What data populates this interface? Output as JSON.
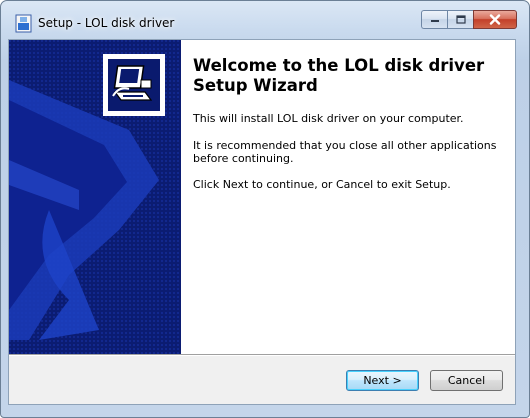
{
  "window": {
    "title": "Setup - LOL disk driver",
    "icons": {
      "app": "setup-app-icon",
      "minimize": "minimize-icon",
      "maximize": "maximize-icon",
      "close": "close-icon"
    }
  },
  "banner": {
    "logo_icon": "computer-disk-icon"
  },
  "welcome": {
    "title": "Welcome to the LOL disk driver Setup Wizard",
    "line1": "This will install LOL disk driver on your computer.",
    "line2": "It is recommended that you close all other applications before continuing.",
    "line3": "Click Next to continue, or Cancel to exit Setup."
  },
  "buttons": {
    "next": "Next >",
    "cancel": "Cancel"
  },
  "colors": {
    "banner_bg": "#0a1a6e",
    "banner_shape": "#1f3fbf",
    "next_border": "#3c7fb1"
  }
}
